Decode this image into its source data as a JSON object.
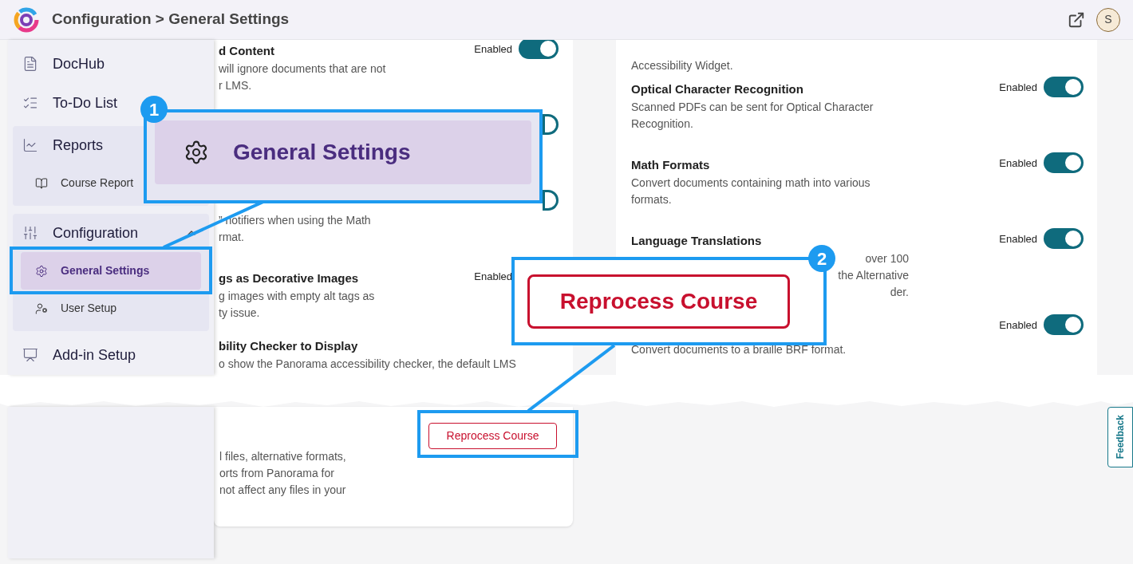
{
  "header": {
    "title": "Configuration > General Settings",
    "avatar": "S"
  },
  "sidebar": {
    "items": [
      {
        "label": "DocHub",
        "kind": "link",
        "selected": false
      },
      {
        "label": "To-Do List",
        "kind": "link",
        "selected": false
      },
      {
        "label": "Reports",
        "kind": "group",
        "expanded": true,
        "children": [
          {
            "label": "Course Report",
            "selected": false
          }
        ]
      },
      {
        "label": "Configuration",
        "kind": "group",
        "expanded": true,
        "children": [
          {
            "label": "General Settings",
            "selected": true
          },
          {
            "label": "User Setup",
            "selected": false
          }
        ]
      },
      {
        "label": "Add-in Setup",
        "kind": "link",
        "selected": false
      }
    ]
  },
  "left_card": {
    "rows": [
      {
        "title": "d Content",
        "status": "Enabled",
        "on": true,
        "description": [
          "will ignore documents that are not",
          "r LMS."
        ]
      },
      {
        "on": true,
        "kind": "clipped"
      },
      {
        "on": true,
        "kind": "clipped",
        "description": [
          "” notifiers when using the Math",
          "rmat."
        ]
      },
      {
        "title": "gs as Decorative Images",
        "status": "Enabled",
        "description": [
          "g images with empty alt tags as",
          "ty issue."
        ]
      },
      {
        "title": "bility Checker to Display",
        "description": [
          "o show the Panorama accessibility checker, the default LMS"
        ]
      }
    ],
    "bottom": {
      "description": [
        "l files, alternative formats,",
        "orts from Panorama for",
        "not affect any files in your"
      ],
      "button": "Reprocess Course"
    }
  },
  "right_card": {
    "rows": [
      {
        "description": [
          "Accessibility Widget."
        ]
      },
      {
        "title": "Optical Character Recognition",
        "status": "Enabled",
        "on": true,
        "description": [
          "Scanned PDFs can be sent for Optical Character",
          "Recognition."
        ]
      },
      {
        "title": "Math Formats",
        "status": "Enabled",
        "on": true,
        "description": [
          "Convert documents containing math into various",
          "formats."
        ]
      },
      {
        "title": "Language Translations",
        "status": "Enabled",
        "on": true,
        "kind": "covered",
        "description": [
          "over 100",
          "the Alternative",
          "der."
        ]
      },
      {
        "status": "Enabled",
        "on": true,
        "description": [
          "Convert documents to a braille BRF format."
        ]
      }
    ]
  },
  "feedback": "Feedback",
  "callouts": [
    {
      "number": "1",
      "kind": "menu",
      "label": "General Settings"
    },
    {
      "number": "2",
      "kind": "button",
      "label": "Reprocess Course"
    }
  ]
}
